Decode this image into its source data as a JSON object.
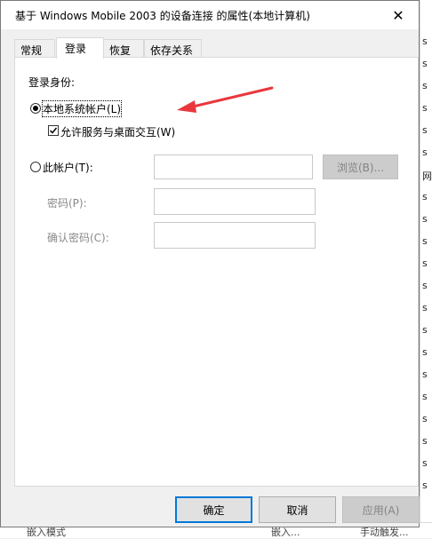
{
  "dialog": {
    "title": "基于 Windows Mobile 2003 的设备连接 的属性(本地计算机)",
    "close_glyph": "✕"
  },
  "tabs": [
    {
      "label": "常规"
    },
    {
      "label": "登录"
    },
    {
      "label": "恢复"
    },
    {
      "label": "依存关系"
    }
  ],
  "logon": {
    "section_label": "登录身份:",
    "local_system_label": "本地系统帐户(L)",
    "local_system_selected": true,
    "allow_desktop_label": "允许服务与桌面交互(W)",
    "allow_desktop_checked": true,
    "this_account_label": "此帐户(T):",
    "this_account_value": "",
    "browse_label": "浏览(B)...",
    "password_label": "密码(P):",
    "password_value": "",
    "confirm_password_label": "确认密码(C):",
    "confirm_password_value": ""
  },
  "buttons": {
    "ok": "确定",
    "cancel": "取消",
    "apply": "应用(A)"
  },
  "background": {
    "right_chars": [
      "s",
      "s",
      "s",
      "s",
      "s",
      "s",
      "网",
      "s",
      "s",
      "s",
      "s",
      "s",
      "s",
      "s",
      "s",
      "s",
      "s",
      "s",
      "s",
      "s",
      "s"
    ],
    "bottom_items": [
      "嵌入模式",
      "嵌入...",
      "手动触发..."
    ]
  },
  "colors": {
    "accent": "#0078d7",
    "annotation_arrow": "#e8383d"
  }
}
